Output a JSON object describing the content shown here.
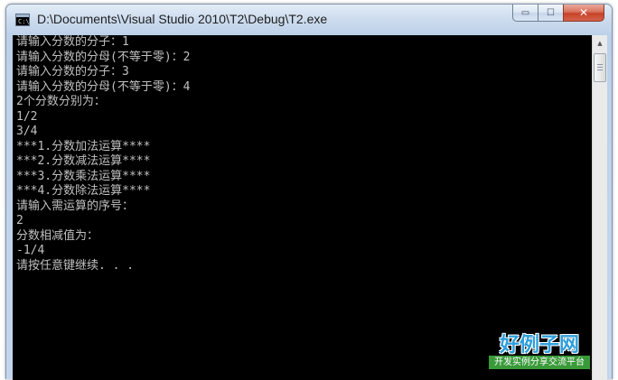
{
  "window": {
    "title": "D:\\Documents\\Visual Studio 2010\\T2\\Debug\\T2.exe",
    "icon_text": "C:\\",
    "buttons": {
      "minimize": "▭",
      "maximize": "☐",
      "close": "✕"
    }
  },
  "console": {
    "lines": [
      "请输入分数的分子：1",
      "请输入分数的分母(不等于零)：2",
      "请输入分数的分子：3",
      "请输入分数的分母(不等于零)：4",
      "2个分数分别为：",
      "1/2",
      "3/4",
      "***1.分数加法运算****",
      "***2.分数减法运算****",
      "***3.分数乘法运算****",
      "***4.分数除法运算****",
      "请输入需运算的序号：",
      "2",
      "分数相减值为：",
      "-1/4",
      "请按任意键继续. . ."
    ]
  },
  "scrollbar": {
    "up_arrow": "▲",
    "down_arrow": "▼"
  },
  "watermark": {
    "main": "好例子网",
    "sub": "开发实例分享交流平台"
  }
}
